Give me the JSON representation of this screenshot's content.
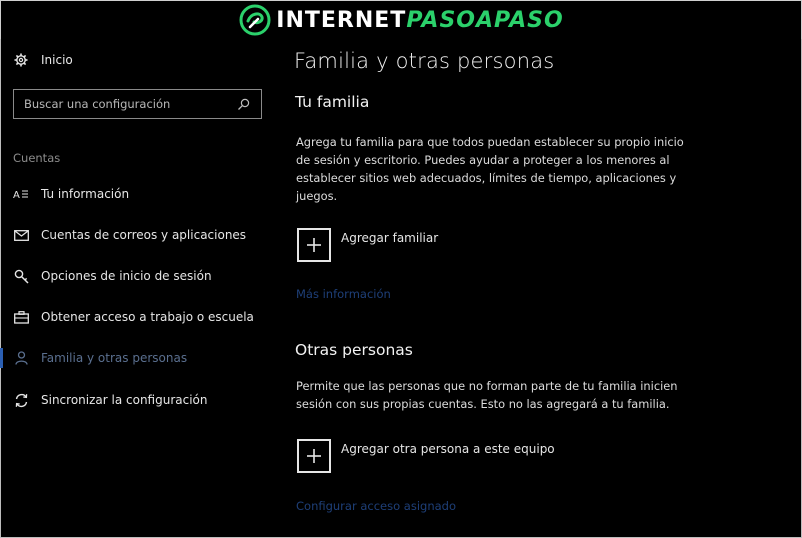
{
  "watermark": {
    "text_white": "INTERNET",
    "text_green": "PASOAPASO"
  },
  "sidebar": {
    "home_label": "Inicio",
    "search_placeholder": "Buscar una configuración",
    "section_label": "Cuentas",
    "items": [
      {
        "label": "Tu información",
        "icon": "person-card-icon"
      },
      {
        "label": "Cuentas de correos y aplicaciones",
        "icon": "mail-icon"
      },
      {
        "label": "Opciones de inicio de sesión",
        "icon": "key-icon"
      },
      {
        "label": "Obtener acceso a trabajo o escuela",
        "icon": "briefcase-icon"
      },
      {
        "label": "Familia y otras personas",
        "icon": "person-icon",
        "active": true
      },
      {
        "label": "Sincronizar la configuración",
        "icon": "sync-icon"
      }
    ]
  },
  "main": {
    "title": "Familia y otras personas",
    "family": {
      "heading": "Tu familia",
      "description": "Agrega tu familia para que todos puedan establecer su propio inicio de sesión y escritorio. Puedes ayudar a proteger a los menores al establecer sitios web adecuados, límites de tiempo, aplicaciones y juegos.",
      "add_label": "Agregar familiar",
      "more_link": "Más información"
    },
    "others": {
      "heading": "Otras personas",
      "description": "Permite que las personas que no forman parte de tu familia inicien sesión con sus propias cuentas. Esto no las agregará a tu familia.",
      "add_label": "Agregar otra persona a este equipo",
      "assigned_link": "Configurar acceso asignado"
    }
  },
  "colors": {
    "background": "#000000",
    "accent": "#2b5fb3",
    "watermark_green": "#2bd16b",
    "link": "#1e3f78"
  }
}
